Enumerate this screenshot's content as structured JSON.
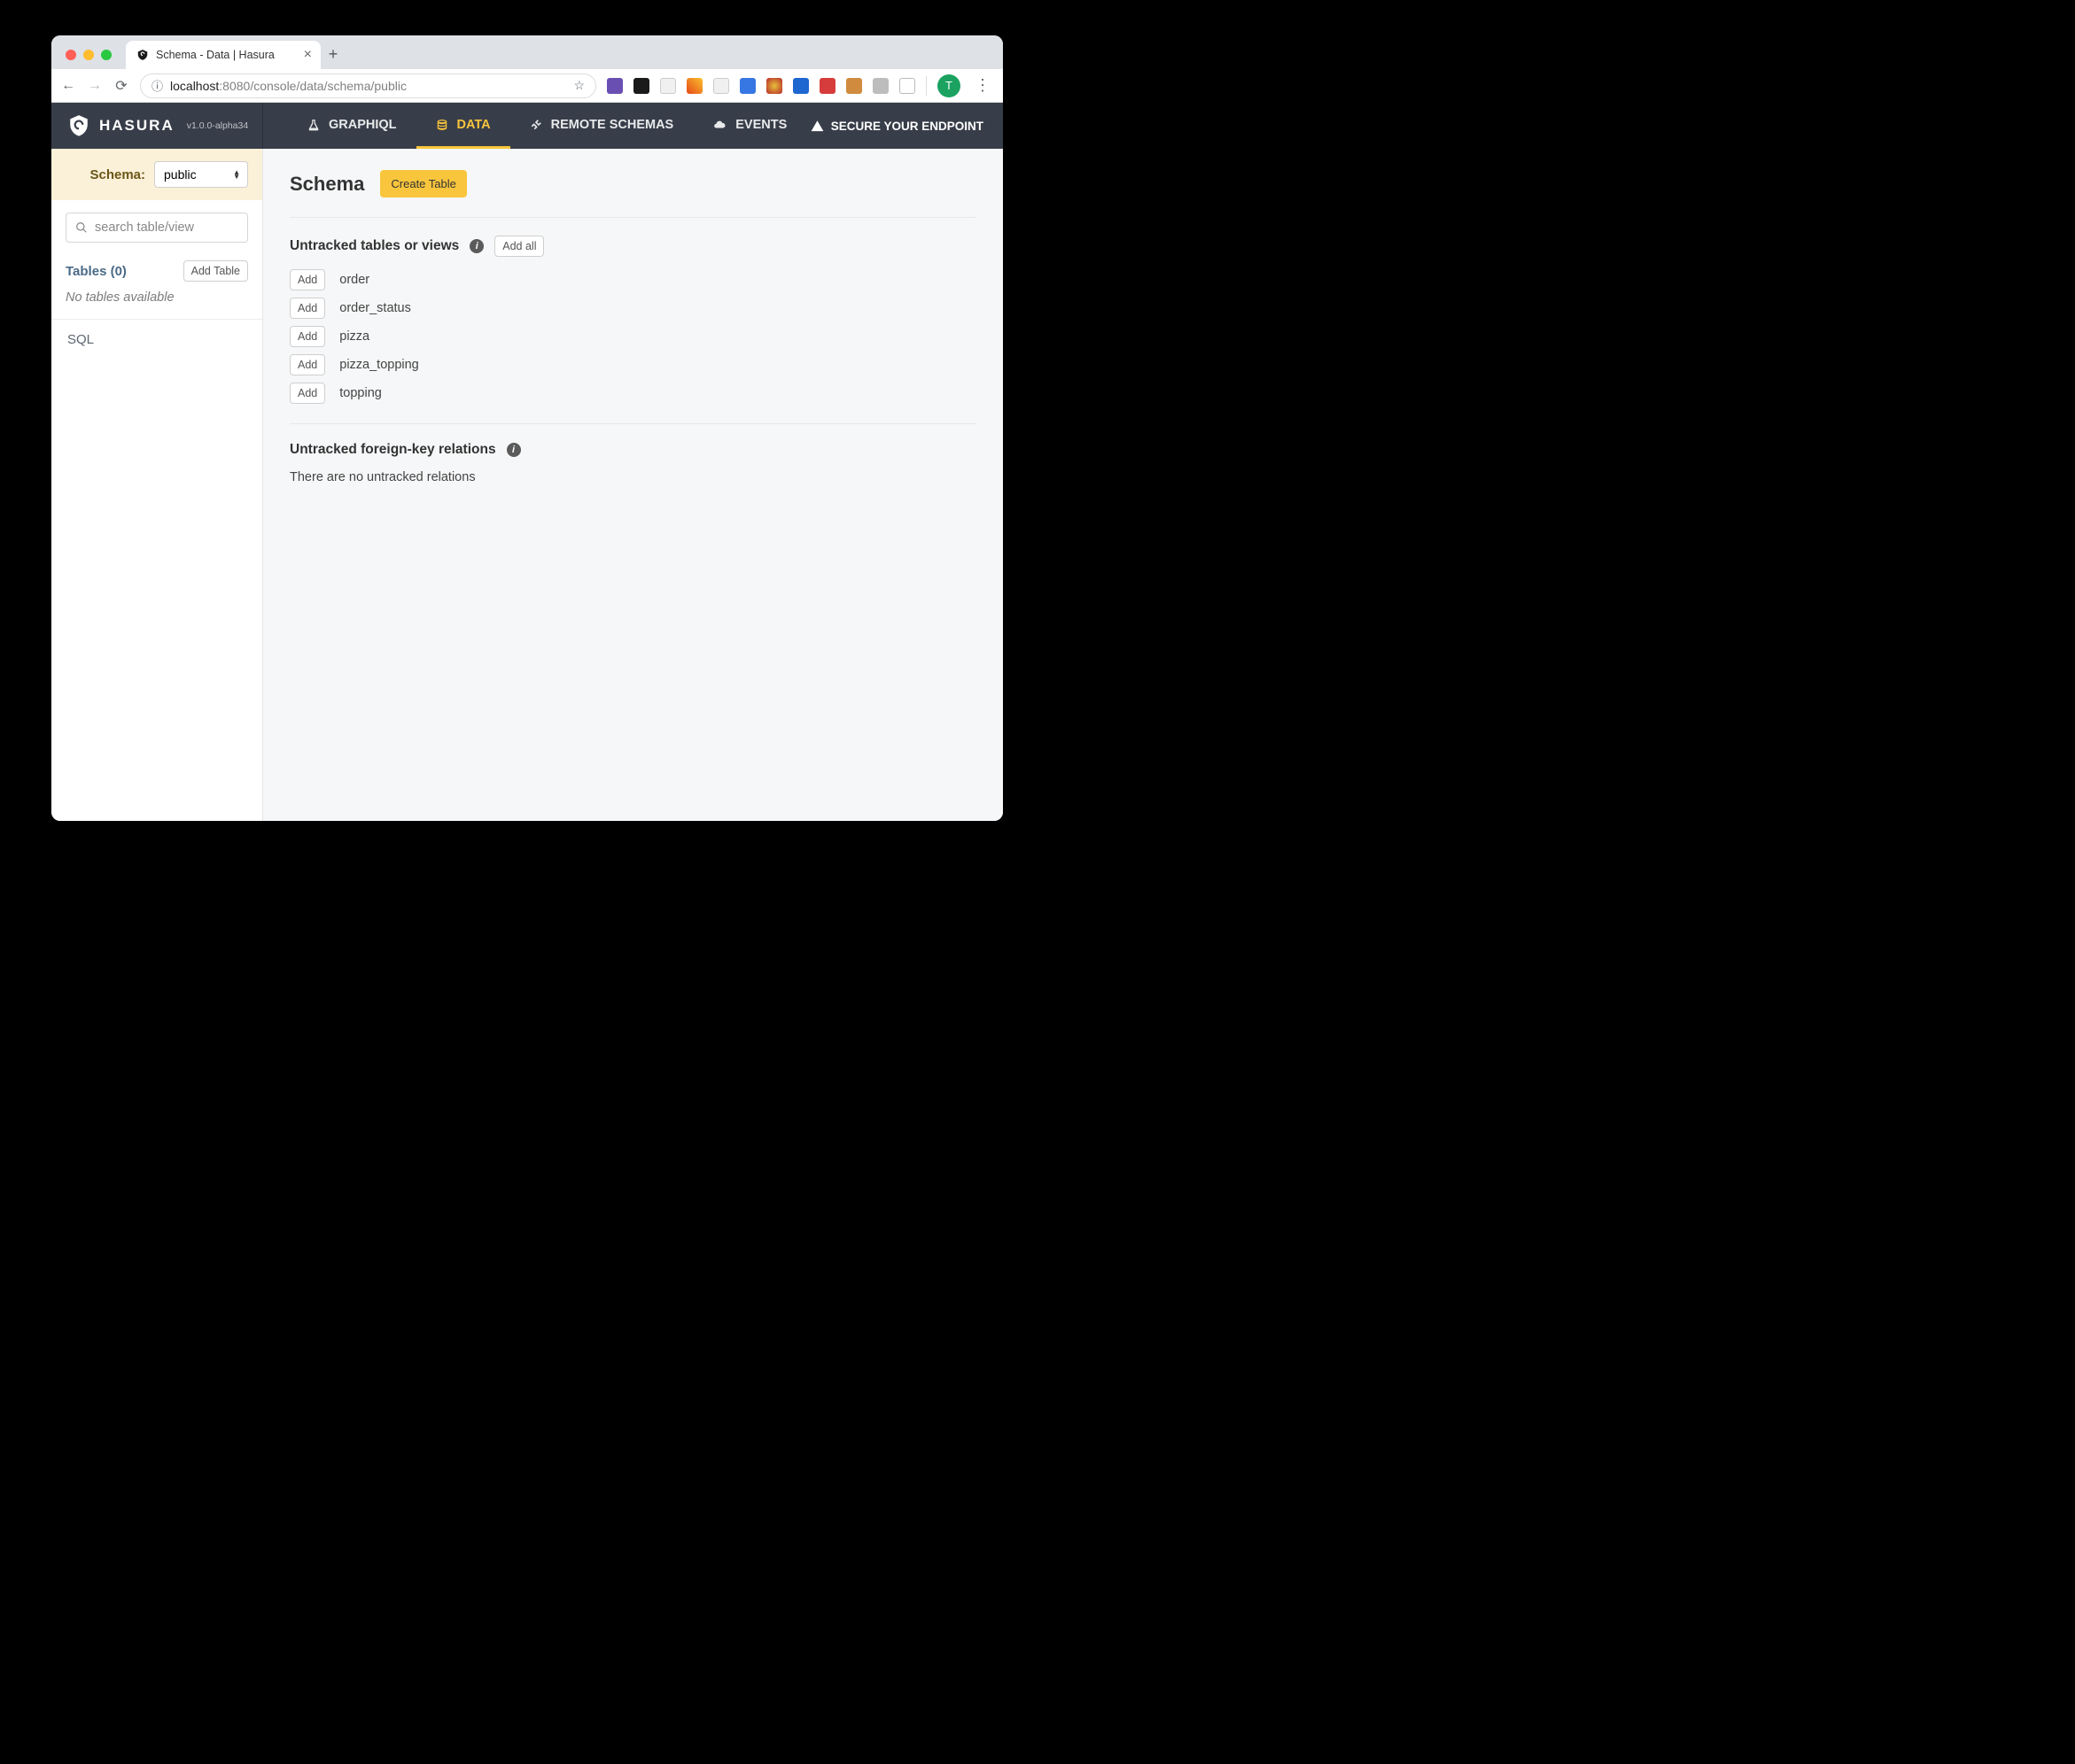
{
  "browser": {
    "tab_title": "Schema - Data | Hasura",
    "url_host": "localhost",
    "url_port_path": ":8080/console/data/schema/public",
    "avatar_letter": "T"
  },
  "header": {
    "brand": "HASURA",
    "version": "v1.0.0-alpha34",
    "tabs": {
      "graphiql": "GRAPHIQL",
      "data": "DATA",
      "remote": "REMOTE SCHEMAS",
      "events": "EVENTS"
    },
    "secure": "SECURE YOUR ENDPOINT"
  },
  "sidebar": {
    "schema_label": "Schema:",
    "schema_value": "public",
    "search_placeholder": "search table/view",
    "tables_label": "Tables (0)",
    "add_table": "Add Table",
    "no_tables": "No tables available",
    "sql": "SQL"
  },
  "main": {
    "title": "Schema",
    "create_table": "Create Table",
    "untracked_title": "Untracked tables or views",
    "add_all": "Add all",
    "add": "Add",
    "tables": [
      "order",
      "order_status",
      "pizza",
      "pizza_topping",
      "topping"
    ],
    "fk_title": "Untracked foreign-key relations",
    "fk_empty": "There are no untracked relations"
  },
  "icons": {
    "ext_colors": [
      "#6a4fb3",
      "#1a1a1a",
      "#f0f0f0",
      "#e64a19",
      "#f0f0f0",
      "#3777e3",
      "#b72929",
      "#1e66d0",
      "#d63c3c",
      "#d08b3e",
      "#bdbdbd",
      "#bdbdbd"
    ]
  }
}
